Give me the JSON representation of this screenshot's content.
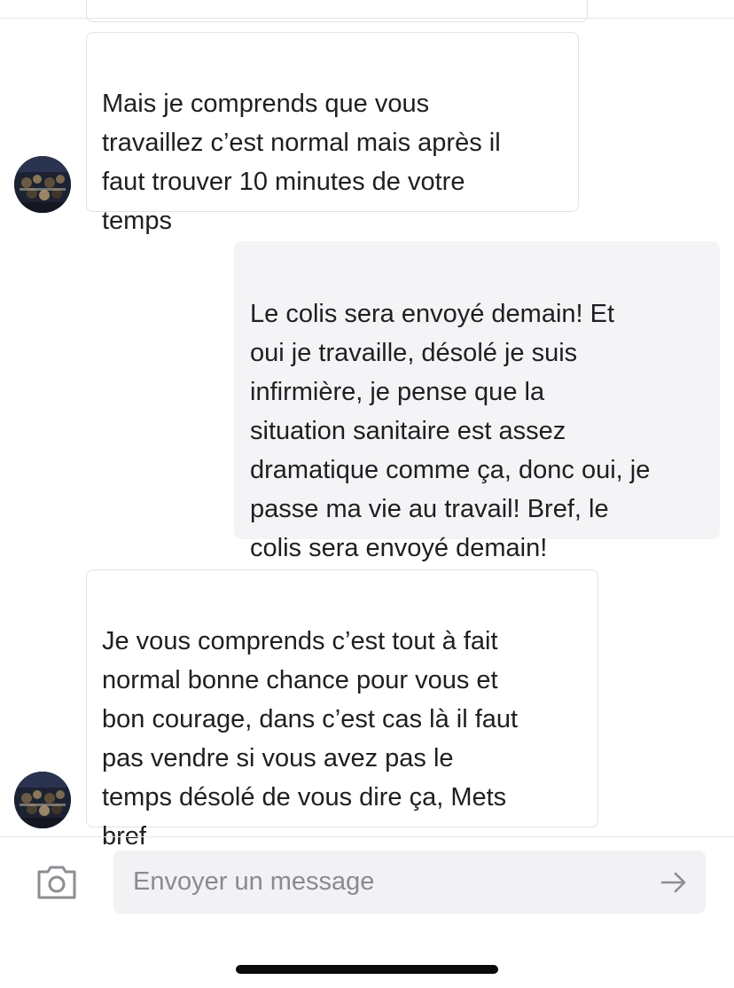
{
  "messages": [
    {
      "direction": "incoming",
      "text": "Mais je comprends que vous\ntravaillez c’est normal mais après il\nfaut trouver 10 minutes de votre\ntemps"
    },
    {
      "direction": "outgoing",
      "text": "Le colis sera envoyé demain! Et\noui je travaille, désolé je suis\ninfirmière, je pense que la\nsituation sanitaire est assez\ndramatique comme ça, donc oui, je\npasse ma vie au travail! Bref, le\ncolis sera envoyé demain!"
    },
    {
      "direction": "incoming",
      "text": "Je vous comprends c’est tout à fait\nnormal bonne chance pour vous et\nbon courage,  dans c’est cas là il faut\npas vendre si vous avez pas le\ntemps désolé de vous dire ça, Mets\nbref"
    }
  ],
  "composer": {
    "placeholder": "Envoyer un message",
    "value": "",
    "camera_icon": "camera-icon",
    "send_icon": "arrow-right-icon"
  },
  "colors": {
    "incoming_bg": "#ffffff",
    "outgoing_bg": "#f4f4f6",
    "input_bg": "#f2f2f4",
    "text": "#1f1f22",
    "placeholder": "#8a8a90"
  }
}
